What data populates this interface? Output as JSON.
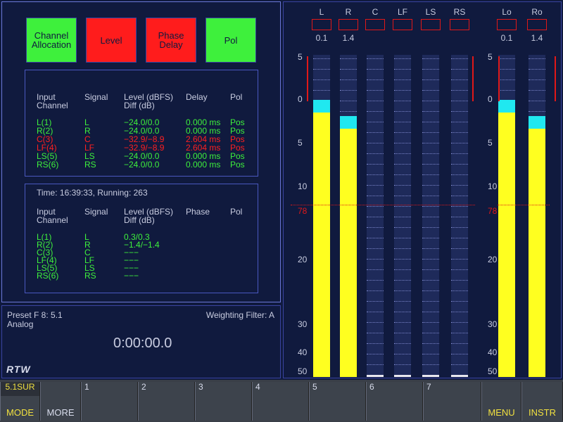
{
  "analyzer": {
    "buttons": [
      {
        "label": "Channel\nAllocation",
        "color": "#3ef03c"
      },
      {
        "label": "Level",
        "color": "#ff1c1c"
      },
      {
        "label": "Phase\nDelay",
        "color": "#ff1c1c"
      },
      {
        "label": "Pol",
        "color": "#3ef03c"
      }
    ],
    "table1": {
      "headers": {
        "input": "Input\nChannel",
        "signal": "Signal",
        "level": "Level (dBFS)\nDiff (dB)",
        "delay": "Delay",
        "pol": "Pol"
      },
      "rows": [
        {
          "input": "L(1)",
          "signal": "L",
          "level": "−24.0/0.0",
          "delay": "0.000 ms",
          "pol": "Pos",
          "status": "ok"
        },
        {
          "input": "R(2)",
          "signal": "R",
          "level": "−24.0/0.0",
          "delay": "0.000 ms",
          "pol": "Pos",
          "status": "ok"
        },
        {
          "input": "C(3)",
          "signal": "C",
          "level": "−32.9/−8.9",
          "delay": "2.604 ms",
          "pol": "Pos",
          "status": "error"
        },
        {
          "input": "LF(4)",
          "signal": "LF",
          "level": "−32.9/−8.9",
          "delay": "2.604 ms",
          "pol": "Pos",
          "status": "error"
        },
        {
          "input": "LS(5)",
          "signal": "LS",
          "level": "−24.0/0.0",
          "delay": "0.000 ms",
          "pol": "Pos",
          "status": "ok"
        },
        {
          "input": "RS(6)",
          "signal": "RS",
          "level": "−24.0/0.0",
          "delay": "0.000 ms",
          "pol": "Pos",
          "status": "ok"
        }
      ]
    },
    "table2": {
      "time_line": "Time: 16:39:33, Running: 263",
      "headers": {
        "input": "Input\nChannel",
        "signal": "Signal",
        "level": "Level (dBFS)\nDiff (dB)",
        "phase": "Phase",
        "pol": "Pol"
      },
      "rows": [
        {
          "input": "L(1)",
          "signal": "L",
          "level": "0.3/0.3"
        },
        {
          "input": "R(2)",
          "signal": "R",
          "level": "−1.4/−1.4"
        },
        {
          "input": "C(3)",
          "signal": "C",
          "level": "−−−"
        },
        {
          "input": "LF(4)",
          "signal": "LF",
          "level": "−−−"
        },
        {
          "input": "LS(5)",
          "signal": "LS",
          "level": "−−−"
        },
        {
          "input": "RS(6)",
          "signal": "RS",
          "level": "−−−"
        }
      ]
    }
  },
  "status": {
    "preset": "Preset F 8: 5.1",
    "source": "Analog",
    "weighting": "Weighting Filter: A",
    "timer": "0:00:00.0",
    "logo": "RTW"
  },
  "meters": {
    "scale_left": [
      "5",
      "0",
      "5",
      "10",
      "78",
      "20",
      "30",
      "40",
      "50"
    ],
    "scale_right": [
      "5",
      "0",
      "5",
      "10",
      "78",
      "20",
      "30",
      "40",
      "50"
    ],
    "reference_mark": "78",
    "channels": [
      {
        "label": "L",
        "value": "0.1",
        "level_fraction": 0.82,
        "peak_fraction": 0.86
      },
      {
        "label": "R",
        "value": "1.4",
        "level_fraction": 0.77,
        "peak_fraction": 0.81
      },
      {
        "label": "C",
        "value": "",
        "level_fraction": 0.0,
        "peak_fraction": 0.0
      },
      {
        "label": "LF",
        "value": "",
        "level_fraction": 0.0,
        "peak_fraction": 0.0
      },
      {
        "label": "LS",
        "value": "",
        "level_fraction": 0.0,
        "peak_fraction": 0.0
      },
      {
        "label": "RS",
        "value": "",
        "level_fraction": 0.0,
        "peak_fraction": 0.0
      },
      {
        "label": "Lo",
        "value": "0.1",
        "level_fraction": 0.82,
        "peak_fraction": 0.86
      },
      {
        "label": "Ro",
        "value": "1.4",
        "level_fraction": 0.77,
        "peak_fraction": 0.81
      }
    ],
    "colors": {
      "level": "#ffff20",
      "peak": "#20e8f0",
      "alarm": "#e01818"
    }
  },
  "softkeys": [
    {
      "top": "5.1SUR",
      "bottom": "MODE"
    },
    {
      "top": "",
      "bottom": "MORE"
    },
    {
      "top": "1",
      "bottom": ""
    },
    {
      "top": "2",
      "bottom": ""
    },
    {
      "top": "3",
      "bottom": ""
    },
    {
      "top": "4",
      "bottom": ""
    },
    {
      "top": "5",
      "bottom": ""
    },
    {
      "top": "6",
      "bottom": ""
    },
    {
      "top": "7",
      "bottom": ""
    },
    {
      "top": "",
      "bottom": "MENU"
    },
    {
      "top": "",
      "bottom": "INSTR"
    }
  ]
}
